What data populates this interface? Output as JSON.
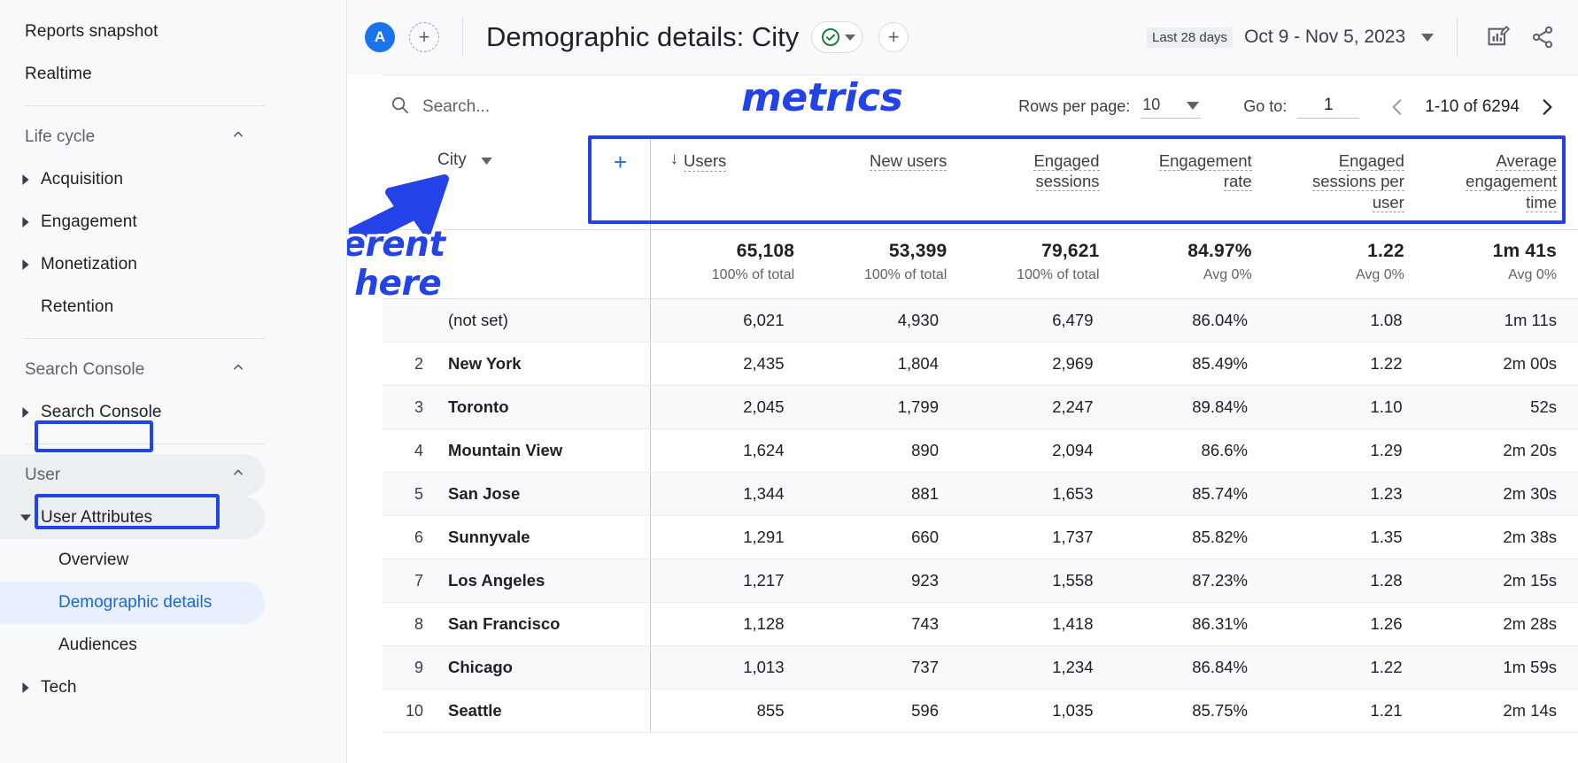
{
  "sidebar": {
    "top_items": [
      {
        "label": "Reports snapshot"
      },
      {
        "label": "Realtime"
      }
    ],
    "sections": [
      {
        "label": "Life cycle",
        "items": [
          {
            "label": "Acquisition",
            "expandable": true
          },
          {
            "label": "Engagement",
            "expandable": true
          },
          {
            "label": "Monetization",
            "expandable": true
          },
          {
            "label": "Retention",
            "expandable": false
          }
        ]
      },
      {
        "label": "Search Console",
        "items": [
          {
            "label": "Search Console",
            "expandable": true
          }
        ]
      },
      {
        "label": "User",
        "items": [
          {
            "label": "User Attributes",
            "expandable": true
          },
          {
            "label": "Overview",
            "child": true
          },
          {
            "label": "Demographic details",
            "child": true,
            "selected": true
          },
          {
            "label": "Audiences",
            "child": true
          },
          {
            "label": "Tech",
            "expandable": true
          }
        ]
      }
    ]
  },
  "header": {
    "avatar_initial": "A",
    "add_account_label": "+",
    "title": "Demographic details: City",
    "status_chip": {
      "icon": "check-circle-icon",
      "caret": "chevron-down-icon"
    },
    "add_comparison_label": "+",
    "date_preset": "Last 28 days",
    "date_range": "Oct 9 - Nov 5, 2023",
    "icons": [
      {
        "name": "edit-chart-icon"
      },
      {
        "name": "share-icon"
      }
    ]
  },
  "toolbar": {
    "search_placeholder": "Search...",
    "search_value": "",
    "rows_per_page_label": "Rows per page:",
    "rows_per_page_value": "10",
    "goto_label": "Go to:",
    "goto_value": "1",
    "pagination_range": "1-10 of 6294"
  },
  "table": {
    "dimension": "City",
    "add_dimension_label": "+",
    "sort_indicator": "↓",
    "columns": [
      "Users",
      "New users",
      "Engaged sessions",
      "Engagement rate",
      "Engaged sessions per user",
      "Average engagement time"
    ],
    "summary": {
      "values": [
        "65,108",
        "53,399",
        "79,621",
        "84.97%",
        "1.22",
        "1m 41s"
      ],
      "subs": [
        "100% of total",
        "100% of total",
        "100% of total",
        "Avg 0%",
        "Avg 0%",
        "Avg 0%"
      ]
    },
    "rows": [
      {
        "rank": "",
        "city": "(not set)",
        "values": [
          "6,021",
          "4,930",
          "6,479",
          "86.04%",
          "1.08",
          "1m 11s"
        ]
      },
      {
        "rank": "2",
        "city": "New York",
        "values": [
          "2,435",
          "1,804",
          "2,969",
          "85.49%",
          "1.22",
          "2m 00s"
        ]
      },
      {
        "rank": "3",
        "city": "Toronto",
        "values": [
          "2,045",
          "1,799",
          "2,247",
          "89.84%",
          "1.10",
          "52s"
        ]
      },
      {
        "rank": "4",
        "city": "Mountain View",
        "values": [
          "1,624",
          "890",
          "2,094",
          "86.6%",
          "1.29",
          "2m 20s"
        ]
      },
      {
        "rank": "5",
        "city": "San Jose",
        "values": [
          "1,344",
          "881",
          "1,653",
          "85.74%",
          "1.23",
          "2m 30s"
        ]
      },
      {
        "rank": "6",
        "city": "Sunnyvale",
        "values": [
          "1,291",
          "660",
          "1,737",
          "85.82%",
          "1.35",
          "2m 38s"
        ]
      },
      {
        "rank": "7",
        "city": "Los Angeles",
        "values": [
          "1,217",
          "923",
          "1,558",
          "87.23%",
          "1.28",
          "2m 15s"
        ]
      },
      {
        "rank": "8",
        "city": "San Francisco",
        "values": [
          "1,128",
          "743",
          "1,418",
          "86.31%",
          "1.26",
          "2m 28s"
        ]
      },
      {
        "rank": "9",
        "city": "Chicago",
        "values": [
          "1,013",
          "737",
          "1,234",
          "86.84%",
          "1.22",
          "1m 59s"
        ]
      },
      {
        "rank": "10",
        "city": "Seattle",
        "values": [
          "855",
          "596",
          "1,035",
          "85.75%",
          "1.21",
          "2m 14s"
        ]
      }
    ]
  },
  "annotations": {
    "metrics_label": "metrics",
    "attributes_label_line1": "select different",
    "attributes_label_line2": "attributes here",
    "highlight_color": "#2342e8"
  }
}
